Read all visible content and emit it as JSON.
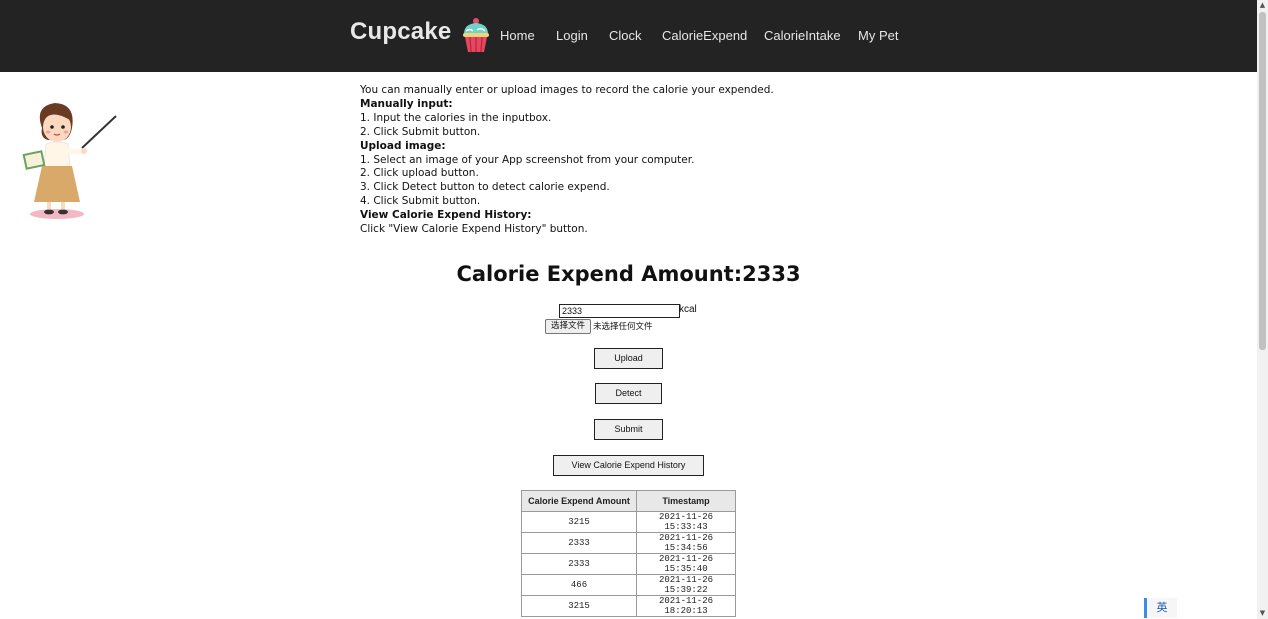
{
  "nav": {
    "brand": "Cupcake",
    "links": [
      "Home",
      "Login",
      "Clock",
      "CalorieExpend",
      "CalorieIntake",
      "My Pet"
    ]
  },
  "instructions": {
    "intro": "You can manually enter or upload images to record the calorie your expended.",
    "manual_heading": "Manually input:",
    "manual_steps": [
      "1. Input the calories in the inputbox.",
      "2. Click Submit button."
    ],
    "upload_heading": "Upload image:",
    "upload_steps": [
      "1. Select an image of your App screenshot from your computer.",
      "2. Click upload button.",
      "3. Click Detect button to detect calorie expend.",
      "4. Click Submit button."
    ],
    "history_heading": "View Calorie Expend History:",
    "history_text": "Click \"View Calorie Expend History\" button."
  },
  "main": {
    "title": "Calorie Expend Amount:2333",
    "calorie_value": "2333",
    "unit": "kcal",
    "file_button": "选择文件",
    "file_status": "未选择任何文件",
    "upload_button": "Upload",
    "detect_button": "Detect",
    "submit_button": "Submit",
    "history_button": "View Calorie Expend History"
  },
  "history_table": {
    "headers": [
      "Calorie Expend Amount",
      "Timestamp"
    ],
    "rows": [
      [
        "3215",
        "2021-11-26 15:33:43"
      ],
      [
        "2333",
        "2021-11-26 15:34:56"
      ],
      [
        "2333",
        "2021-11-26 15:35:40"
      ],
      [
        "466",
        "2021-11-26 15:39:22"
      ],
      [
        "3215",
        "2021-11-26 18:20:13"
      ]
    ]
  },
  "ime_indicator": "英",
  "colors": {
    "navbar": "#232323",
    "nav_text": "#e6e6e6",
    "ime_accent": "#3a8ee6"
  }
}
